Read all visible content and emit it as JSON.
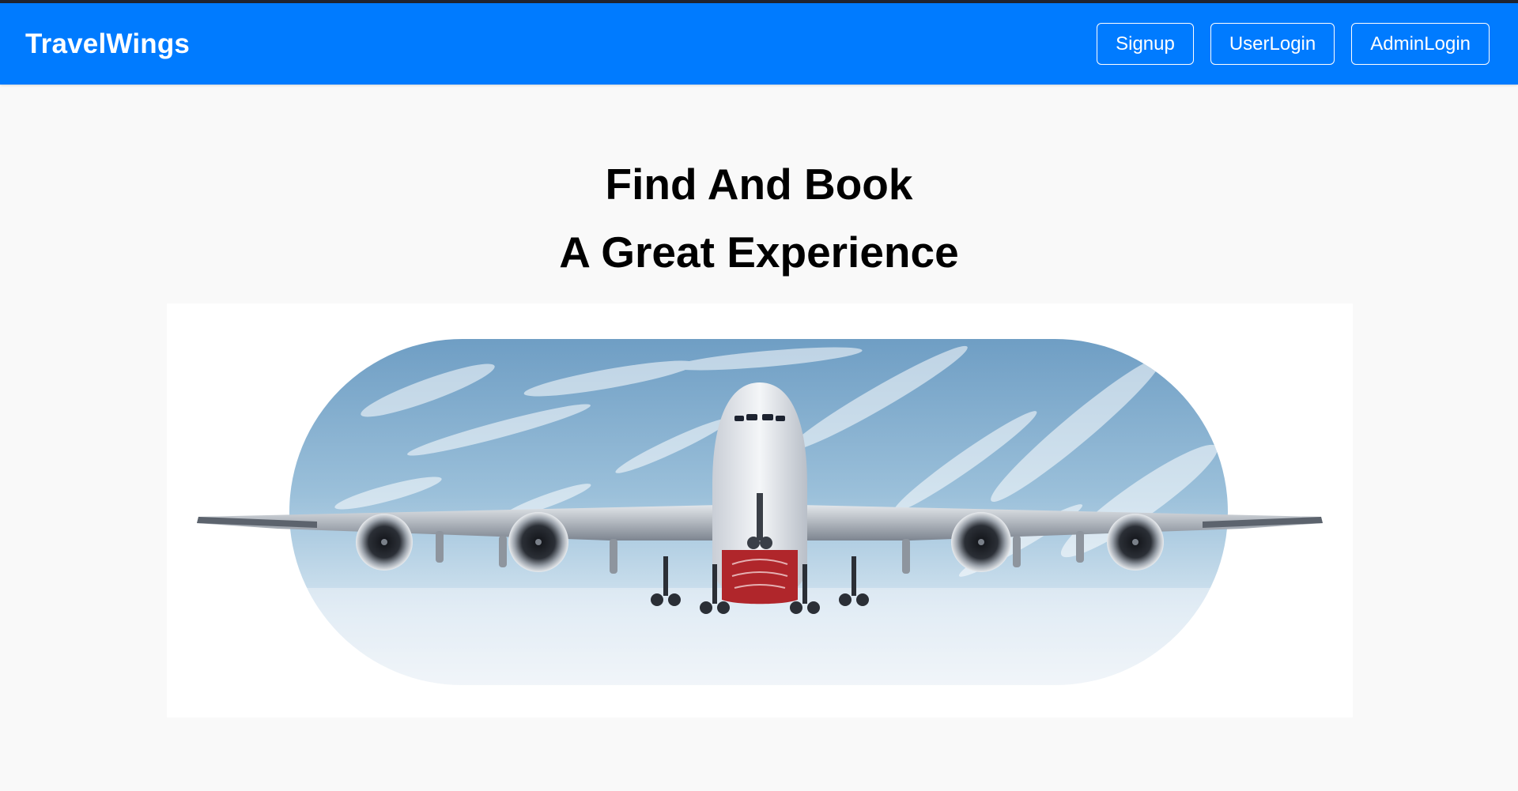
{
  "navbar": {
    "brand": "TravelWings",
    "buttons": {
      "signup": "Signup",
      "user_login": "UserLogin",
      "admin_login": "AdminLogin"
    }
  },
  "hero": {
    "line1": "Find And Book",
    "line2": "A Great Experience"
  },
  "colors": {
    "navbar": "#007bff",
    "background": "#f9f9f9"
  },
  "image": {
    "subject": "airplane-in-sky"
  }
}
